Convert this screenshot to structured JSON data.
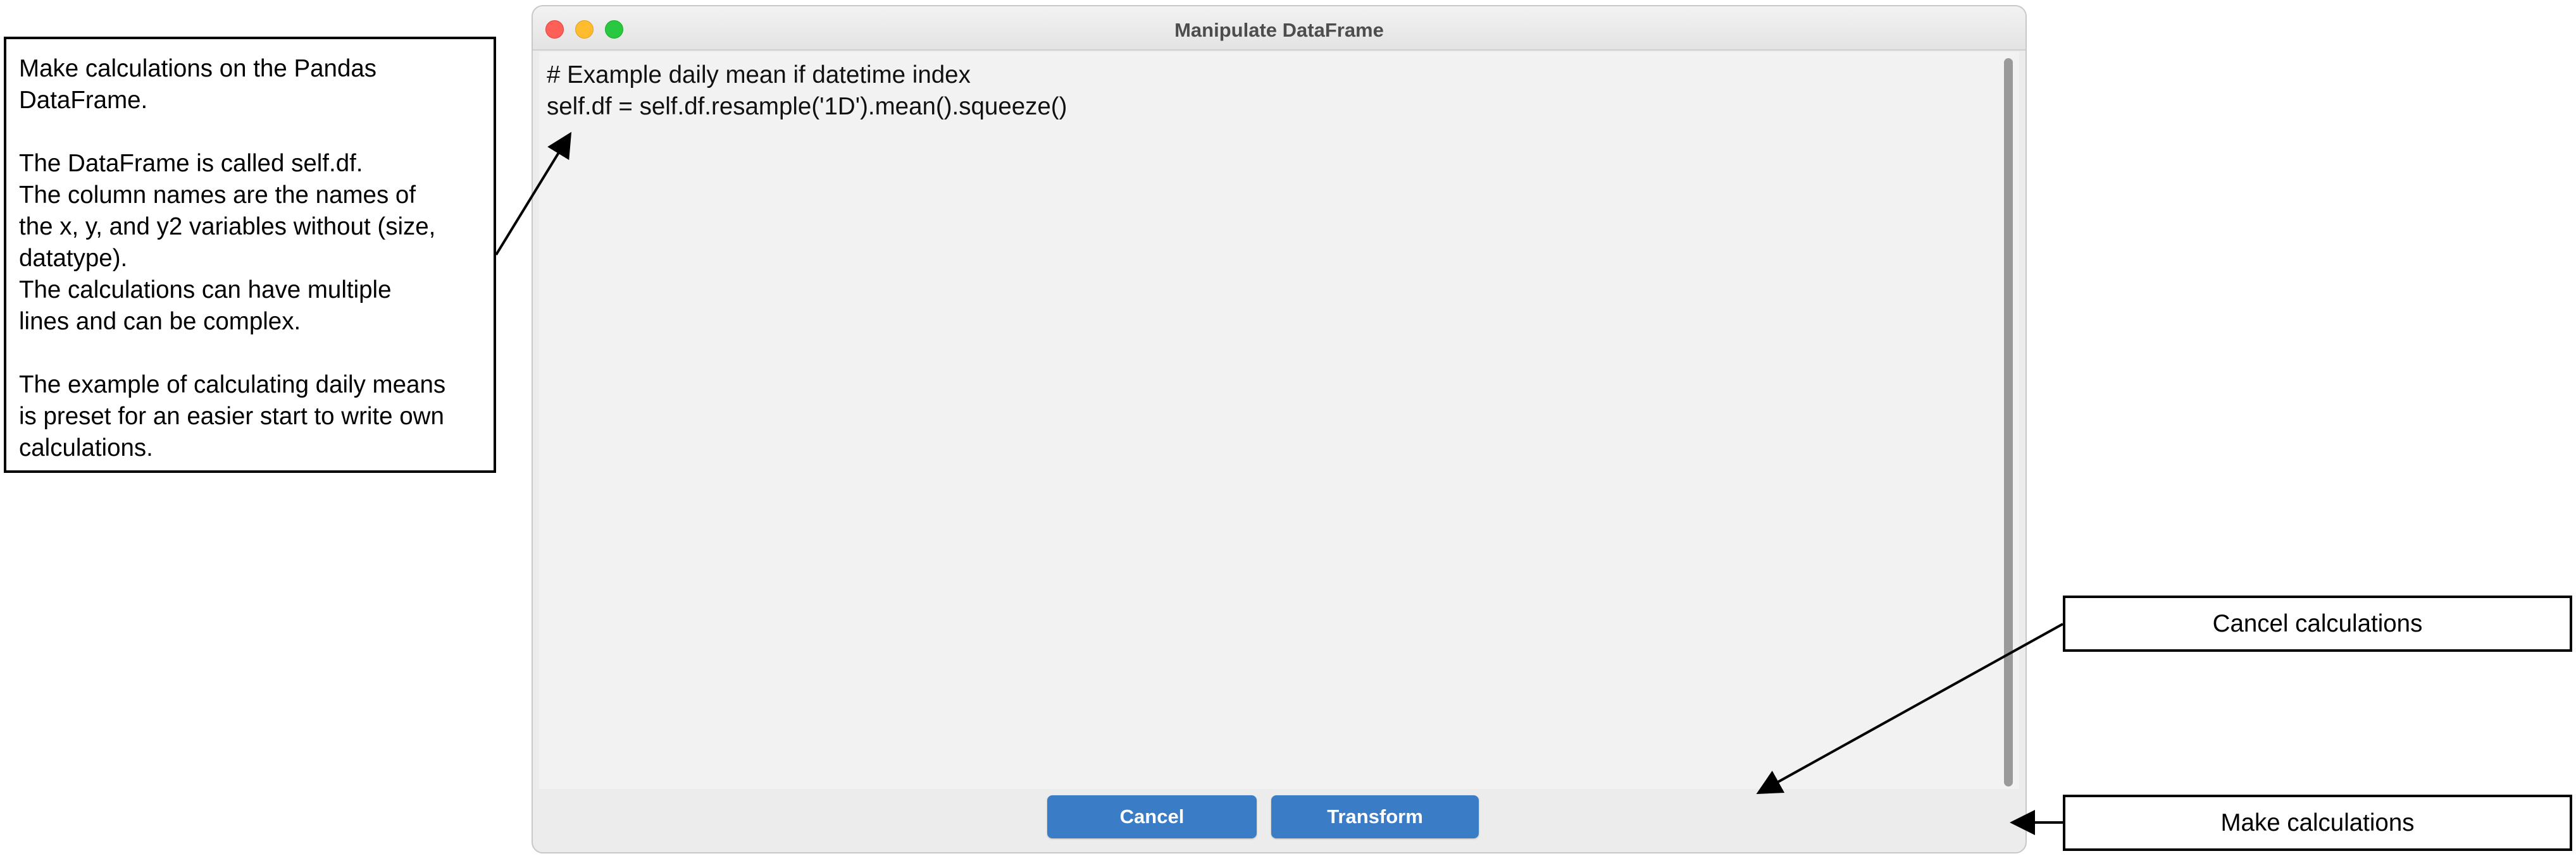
{
  "window": {
    "title": "Manipulate DataFrame"
  },
  "editor": {
    "lines": [
      "# Example daily mean if datetime index",
      "self.df = self.df.resample('1D').mean().squeeze()"
    ]
  },
  "buttons": {
    "cancel_label": "Cancel",
    "transform_label": "Transform"
  },
  "annotations": {
    "left_paragraphs": [
      [
        "Make calculations on the Pandas",
        "DataFrame."
      ],
      [
        "The DataFrame is called self.df.",
        "The column names are the names of",
        "the x, y, and y2 variables without (size,",
        "datatype).",
        "The calculations can have multiple",
        "lines and can be complex."
      ],
      [
        "The example of calculating daily means",
        "is preset for an easier start to write own",
        "calculations."
      ]
    ],
    "cancel_note": "Cancel calculations",
    "make_note": "Make calculations"
  },
  "colors": {
    "button_blue": "#3b7cc6",
    "close": "#fe5f57",
    "minimize": "#febc2e",
    "maximize": "#28c840"
  }
}
